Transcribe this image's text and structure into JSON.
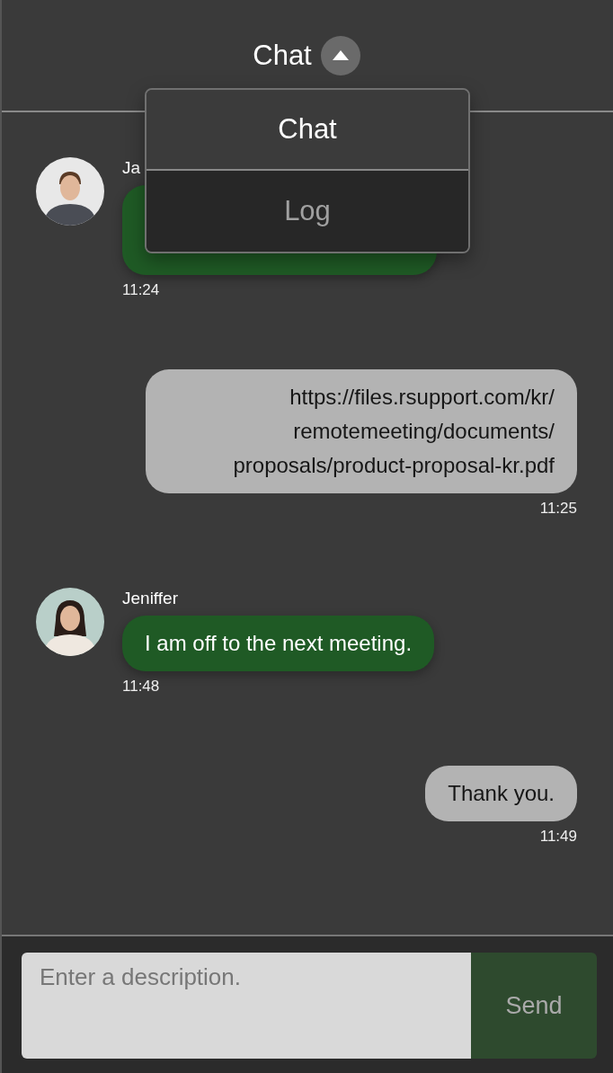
{
  "header": {
    "title": "Chat",
    "menu_expanded": true
  },
  "menu": {
    "items": [
      {
        "label": "Chat",
        "selected": true
      },
      {
        "label": "Log",
        "selected": false
      }
    ]
  },
  "messages": [
    {
      "kind": "received",
      "sender": "Ja",
      "time": "11:24"
    },
    {
      "kind": "sent",
      "text": "https://files.rsupport.com/kr/ remotemeeting/documents/ proposals/product-proposal-kr.pdf",
      "time": "11:25"
    },
    {
      "kind": "received",
      "sender": "Jeniffer",
      "text": "I am off to the next meeting.",
      "time": "11:48"
    },
    {
      "kind": "sent",
      "text": "Thank you.",
      "time": "11:49"
    }
  ],
  "composer": {
    "placeholder": "Enter a description.",
    "button": "Send"
  }
}
